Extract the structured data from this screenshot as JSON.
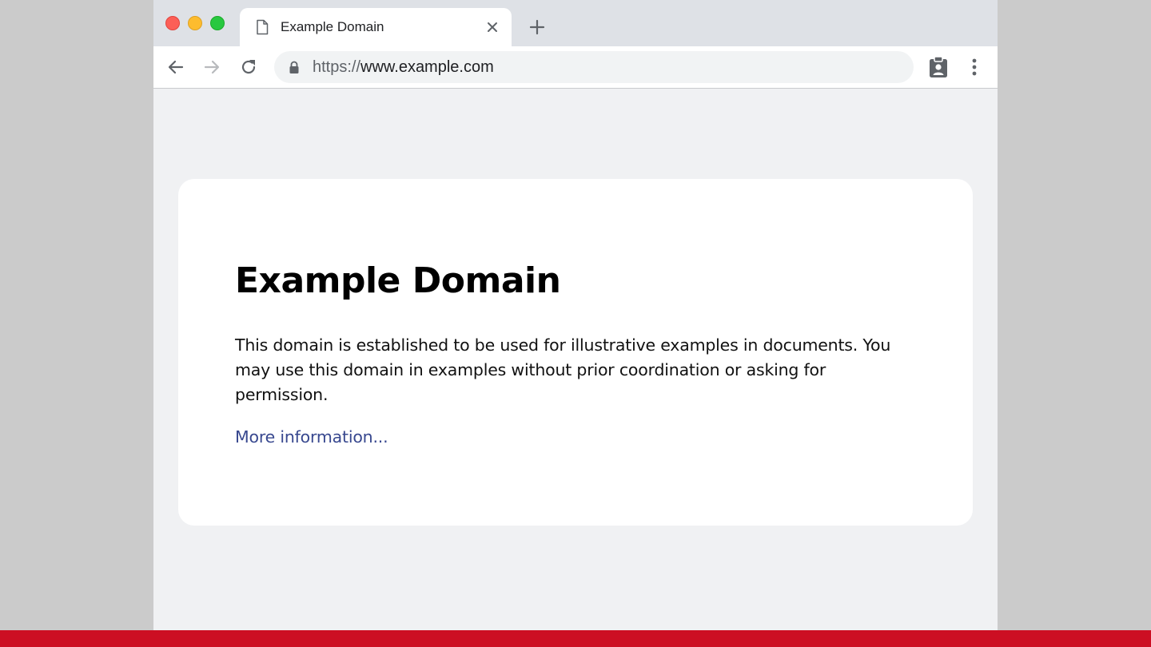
{
  "window": {
    "controls": [
      "close",
      "minimize",
      "zoom"
    ]
  },
  "tab": {
    "title": "Example Domain",
    "icon": "page-icon",
    "close_icon": "close-icon"
  },
  "new_tab_icon": "plus-icon",
  "toolbar": {
    "back_icon": "arrow-left-icon",
    "forward_icon": "arrow-right-icon",
    "reload_icon": "reload-icon",
    "url_scheme": "https://",
    "url_host": "www.example.com",
    "secure_icon": "lock-icon",
    "extension_icon": "clipboard-account-icon",
    "menu_icon": "more-vertical-icon"
  },
  "page": {
    "heading": "Example Domain",
    "description": "This domain is established to be used for illustrative examples in documents. You may use this domain in examples without prior coordination or asking for permission.",
    "link_text": "More information..."
  },
  "colors": {
    "background": "#cbcbcb",
    "accent_bar": "#cc0f23",
    "link": "#38488f",
    "traffic_close": "#fc5f57",
    "traffic_minimize": "#fdbc2e",
    "traffic_zoom": "#28c840"
  }
}
